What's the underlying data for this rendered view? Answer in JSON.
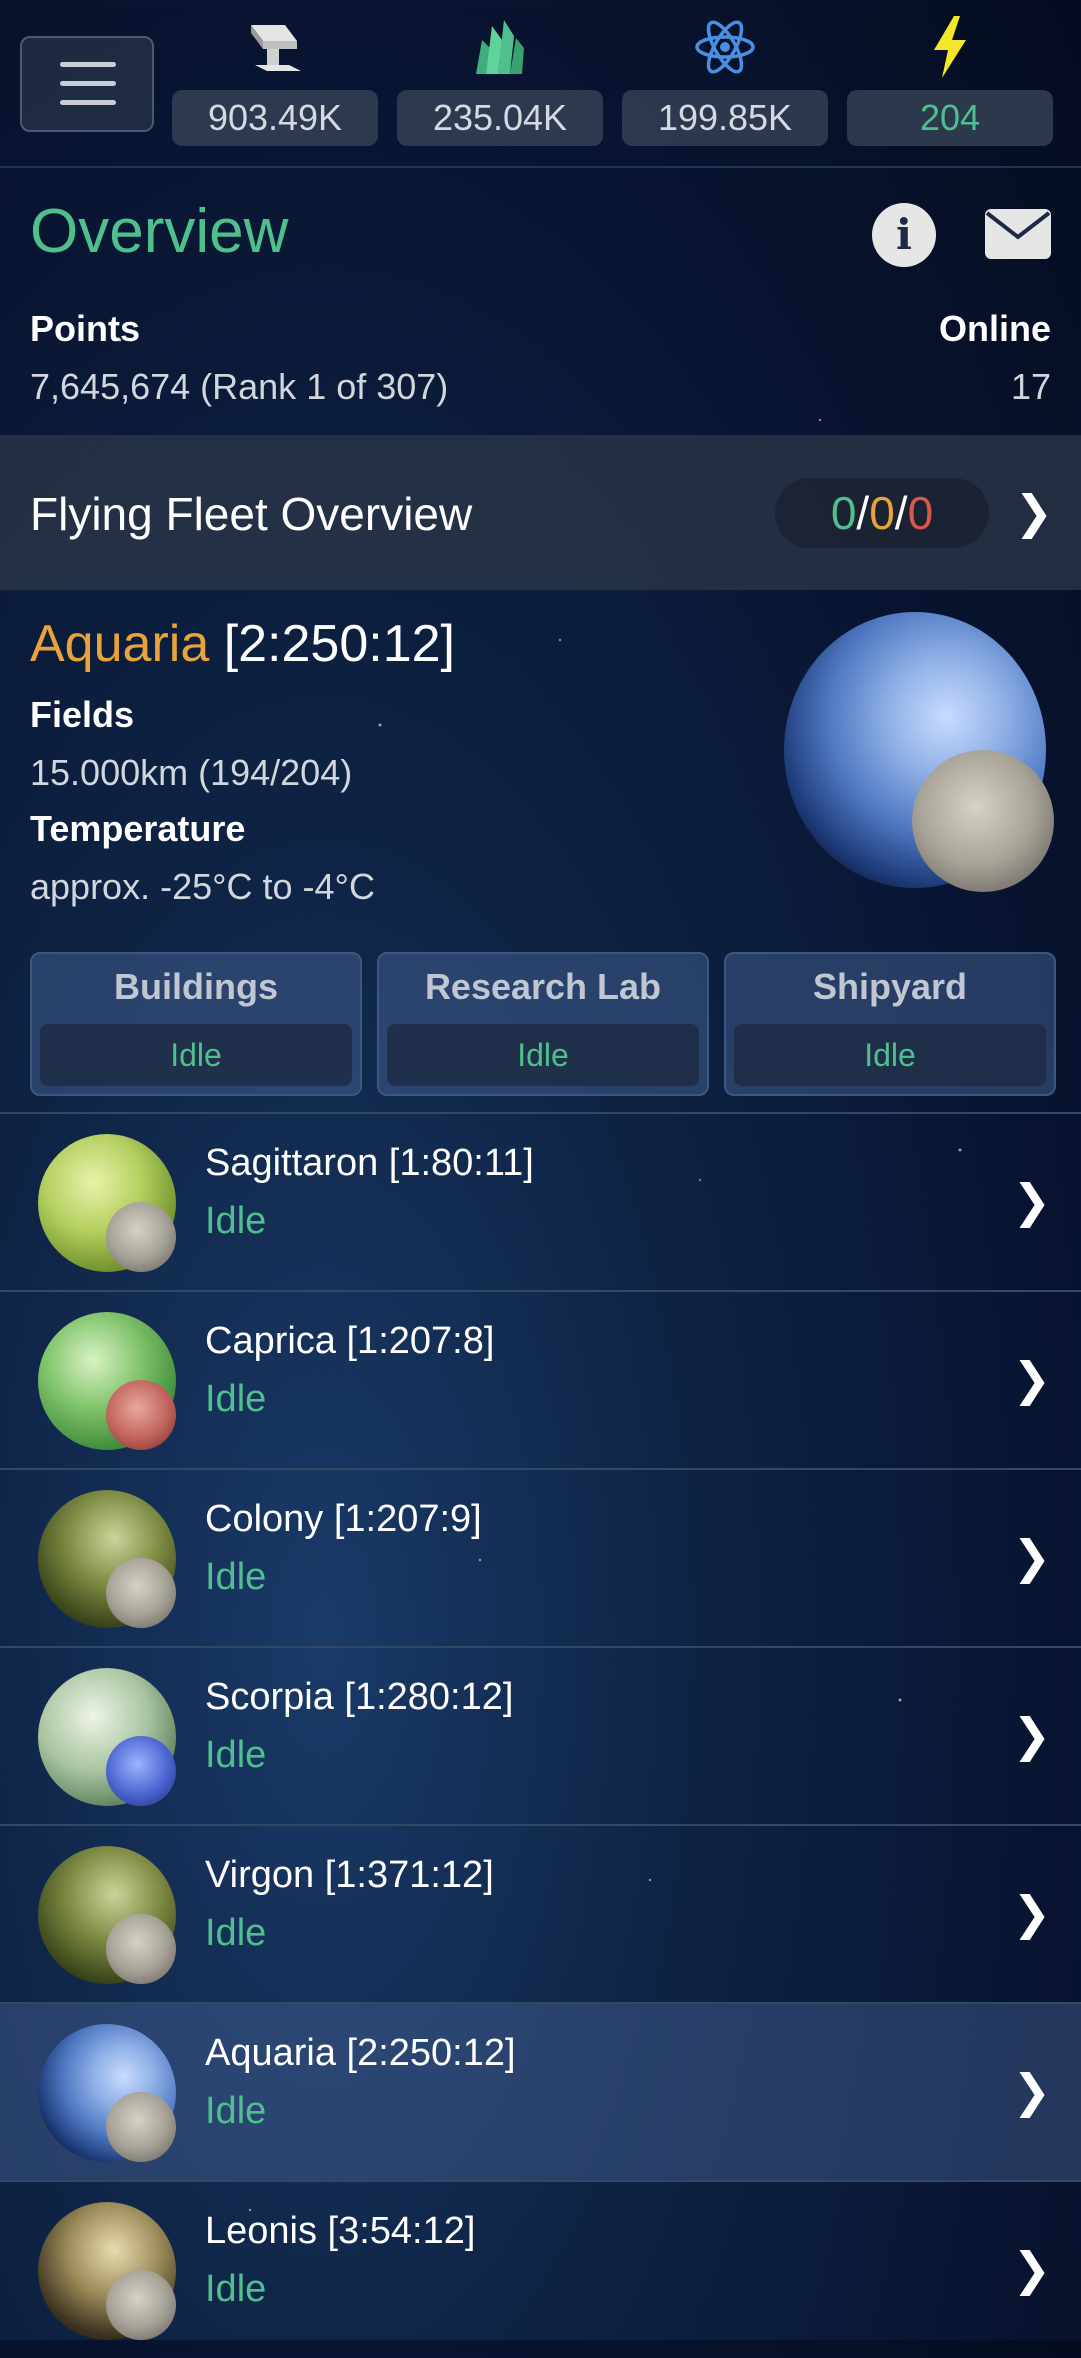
{
  "resources": [
    {
      "icon": "metal-ingot-icon",
      "value": "903.49K"
    },
    {
      "icon": "crystal-icon",
      "value": "235.04K"
    },
    {
      "icon": "atom-icon",
      "value": "199.85K"
    },
    {
      "icon": "lightning-icon",
      "value": "204"
    }
  ],
  "overview": {
    "title": "Overview",
    "points_label": "Points",
    "points_value": "7,645,674 (Rank 1 of 307)",
    "online_label": "Online",
    "online_value": "17"
  },
  "fleet": {
    "title": "Flying Fleet Overview",
    "own": "0",
    "sep1": "/",
    "friendly": "0",
    "sep2": "/",
    "hostile": "0"
  },
  "current_planet": {
    "name": "Aquaria",
    "coords": "[2:250:12]",
    "fields_label": "Fields",
    "fields_value": "15.000km (194/204)",
    "temp_label": "Temperature",
    "temp_value": "approx. -25°C to -4°C"
  },
  "queues": [
    {
      "title": "Buildings",
      "status": "Idle"
    },
    {
      "title": "Research Lab",
      "status": "Idle"
    },
    {
      "title": "Shipyard",
      "status": "Idle"
    }
  ],
  "planets": [
    {
      "name": "Sagittaron [1:80:11]",
      "status": "Idle"
    },
    {
      "name": "Caprica [1:207:8]",
      "status": "Idle"
    },
    {
      "name": "Colony [1:207:9]",
      "status": "Idle"
    },
    {
      "name": "Scorpia [1:280:12]",
      "status": "Idle"
    },
    {
      "name": "Virgon [1:371:12]",
      "status": "Idle"
    },
    {
      "name": "Aquaria [2:250:12]",
      "status": "Idle",
      "active": true
    },
    {
      "name": "Leonis [3:54:12]",
      "status": "Idle"
    }
  ],
  "colors": {
    "green": "#4fc08d",
    "orange": "#e8a33a",
    "red": "#d9584a",
    "energy": "#f4e62a"
  }
}
